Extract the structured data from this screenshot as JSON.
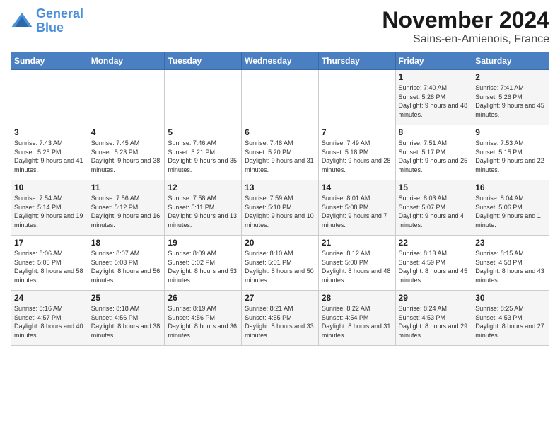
{
  "header": {
    "logo_line1": "General",
    "logo_line2": "Blue",
    "month": "November 2024",
    "location": "Sains-en-Amienois, France"
  },
  "days_of_week": [
    "Sunday",
    "Monday",
    "Tuesday",
    "Wednesday",
    "Thursday",
    "Friday",
    "Saturday"
  ],
  "weeks": [
    [
      {
        "day": "",
        "info": ""
      },
      {
        "day": "",
        "info": ""
      },
      {
        "day": "",
        "info": ""
      },
      {
        "day": "",
        "info": ""
      },
      {
        "day": "",
        "info": ""
      },
      {
        "day": "1",
        "info": "Sunrise: 7:40 AM\nSunset: 5:28 PM\nDaylight: 9 hours and 48 minutes."
      },
      {
        "day": "2",
        "info": "Sunrise: 7:41 AM\nSunset: 5:26 PM\nDaylight: 9 hours and 45 minutes."
      }
    ],
    [
      {
        "day": "3",
        "info": "Sunrise: 7:43 AM\nSunset: 5:25 PM\nDaylight: 9 hours and 41 minutes."
      },
      {
        "day": "4",
        "info": "Sunrise: 7:45 AM\nSunset: 5:23 PM\nDaylight: 9 hours and 38 minutes."
      },
      {
        "day": "5",
        "info": "Sunrise: 7:46 AM\nSunset: 5:21 PM\nDaylight: 9 hours and 35 minutes."
      },
      {
        "day": "6",
        "info": "Sunrise: 7:48 AM\nSunset: 5:20 PM\nDaylight: 9 hours and 31 minutes."
      },
      {
        "day": "7",
        "info": "Sunrise: 7:49 AM\nSunset: 5:18 PM\nDaylight: 9 hours and 28 minutes."
      },
      {
        "day": "8",
        "info": "Sunrise: 7:51 AM\nSunset: 5:17 PM\nDaylight: 9 hours and 25 minutes."
      },
      {
        "day": "9",
        "info": "Sunrise: 7:53 AM\nSunset: 5:15 PM\nDaylight: 9 hours and 22 minutes."
      }
    ],
    [
      {
        "day": "10",
        "info": "Sunrise: 7:54 AM\nSunset: 5:14 PM\nDaylight: 9 hours and 19 minutes."
      },
      {
        "day": "11",
        "info": "Sunrise: 7:56 AM\nSunset: 5:12 PM\nDaylight: 9 hours and 16 minutes."
      },
      {
        "day": "12",
        "info": "Sunrise: 7:58 AM\nSunset: 5:11 PM\nDaylight: 9 hours and 13 minutes."
      },
      {
        "day": "13",
        "info": "Sunrise: 7:59 AM\nSunset: 5:10 PM\nDaylight: 9 hours and 10 minutes."
      },
      {
        "day": "14",
        "info": "Sunrise: 8:01 AM\nSunset: 5:08 PM\nDaylight: 9 hours and 7 minutes."
      },
      {
        "day": "15",
        "info": "Sunrise: 8:03 AM\nSunset: 5:07 PM\nDaylight: 9 hours and 4 minutes."
      },
      {
        "day": "16",
        "info": "Sunrise: 8:04 AM\nSunset: 5:06 PM\nDaylight: 9 hours and 1 minute."
      }
    ],
    [
      {
        "day": "17",
        "info": "Sunrise: 8:06 AM\nSunset: 5:05 PM\nDaylight: 8 hours and 58 minutes."
      },
      {
        "day": "18",
        "info": "Sunrise: 8:07 AM\nSunset: 5:03 PM\nDaylight: 8 hours and 56 minutes."
      },
      {
        "day": "19",
        "info": "Sunrise: 8:09 AM\nSunset: 5:02 PM\nDaylight: 8 hours and 53 minutes."
      },
      {
        "day": "20",
        "info": "Sunrise: 8:10 AM\nSunset: 5:01 PM\nDaylight: 8 hours and 50 minutes."
      },
      {
        "day": "21",
        "info": "Sunrise: 8:12 AM\nSunset: 5:00 PM\nDaylight: 8 hours and 48 minutes."
      },
      {
        "day": "22",
        "info": "Sunrise: 8:13 AM\nSunset: 4:59 PM\nDaylight: 8 hours and 45 minutes."
      },
      {
        "day": "23",
        "info": "Sunrise: 8:15 AM\nSunset: 4:58 PM\nDaylight: 8 hours and 43 minutes."
      }
    ],
    [
      {
        "day": "24",
        "info": "Sunrise: 8:16 AM\nSunset: 4:57 PM\nDaylight: 8 hours and 40 minutes."
      },
      {
        "day": "25",
        "info": "Sunrise: 8:18 AM\nSunset: 4:56 PM\nDaylight: 8 hours and 38 minutes."
      },
      {
        "day": "26",
        "info": "Sunrise: 8:19 AM\nSunset: 4:56 PM\nDaylight: 8 hours and 36 minutes."
      },
      {
        "day": "27",
        "info": "Sunrise: 8:21 AM\nSunset: 4:55 PM\nDaylight: 8 hours and 33 minutes."
      },
      {
        "day": "28",
        "info": "Sunrise: 8:22 AM\nSunset: 4:54 PM\nDaylight: 8 hours and 31 minutes."
      },
      {
        "day": "29",
        "info": "Sunrise: 8:24 AM\nSunset: 4:53 PM\nDaylight: 8 hours and 29 minutes."
      },
      {
        "day": "30",
        "info": "Sunrise: 8:25 AM\nSunset: 4:53 PM\nDaylight: 8 hours and 27 minutes."
      }
    ]
  ]
}
